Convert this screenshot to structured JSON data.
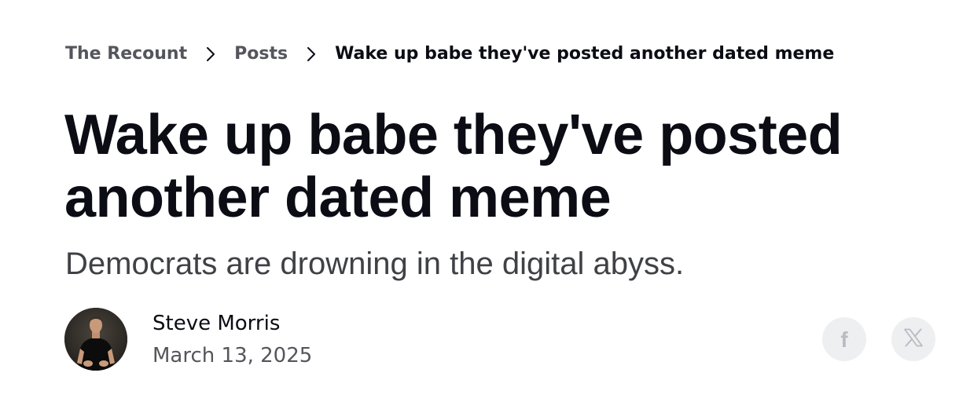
{
  "breadcrumb": {
    "items": [
      {
        "label": "The Recount"
      },
      {
        "label": "Posts"
      },
      {
        "label": "Wake up babe they've posted another dated meme"
      }
    ],
    "separator_icon": "chevron-right-icon"
  },
  "article": {
    "title": "Wake up babe they've posted another dated meme",
    "subtitle": "Democrats are drowning in the digital abyss."
  },
  "author": {
    "name": "Steve Morris",
    "date": "March 13, 2025",
    "avatar_icon": "author-avatar"
  },
  "share": {
    "buttons": [
      {
        "icon": "facebook-icon",
        "glyph": "f"
      },
      {
        "icon": "x-logo-icon"
      }
    ]
  },
  "colors": {
    "text_primary": "#0b0c14",
    "text_muted": "#55565c",
    "subtitle": "#404146",
    "share_bg": "#eeeff1",
    "share_icon": "#b9bcc3"
  }
}
